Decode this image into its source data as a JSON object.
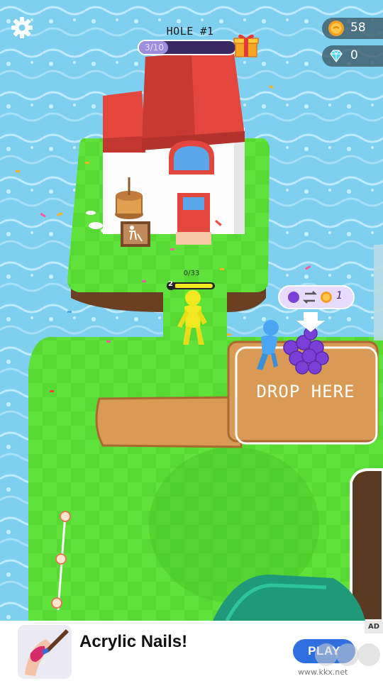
{
  "hud": {
    "level_title": "HOLE #1",
    "level_progress_text": "3/10",
    "level_progress_fraction": 0.3,
    "coins": "58",
    "gems": "0"
  },
  "world": {
    "worker_count": "0/33",
    "worker_level": "2",
    "trade_amount": "1",
    "drop_zone_label": "DROP HERE"
  },
  "ad": {
    "title": "Acrylic Nails!",
    "cta": "PLAY",
    "badge": "AD",
    "watermark": "www.kkx.net"
  },
  "colors": {
    "water": "#7fd0f0",
    "grass": "#5fe23a",
    "dirt": "#d99a55",
    "roof": "#e2463c",
    "accent_purple": "#7b55e0",
    "play_button": "#2f6fe0"
  }
}
